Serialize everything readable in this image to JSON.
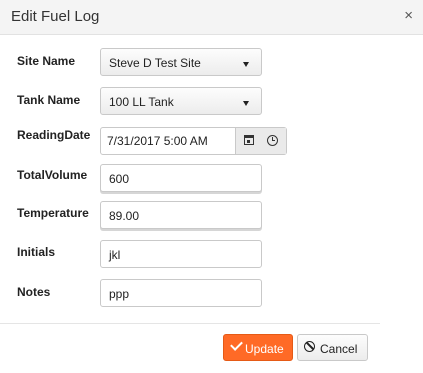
{
  "dialog": {
    "title": "Edit Fuel Log",
    "close_glyph": "×"
  },
  "form": {
    "site_name": {
      "label": "Site Name",
      "value": "Steve D Test Site"
    },
    "tank_name": {
      "label": "Tank Name",
      "value": "100 LL Tank"
    },
    "reading_date": {
      "label": "ReadingDate",
      "value": "7/31/2017 5:00 AM"
    },
    "total_volume": {
      "label": "TotalVolume",
      "value": "600"
    },
    "temperature": {
      "label": "Temperature",
      "value": "89.00"
    },
    "initials": {
      "label": "Initials",
      "value": "jkl"
    },
    "notes": {
      "label": "Notes",
      "value": "ppp"
    }
  },
  "actions": {
    "update_label": "Update",
    "cancel_label": "Cancel"
  },
  "colors": {
    "accent": "#ff6a26"
  },
  "icons": {
    "calendar": "calendar-icon",
    "clock": "clock-icon",
    "check": "check-icon",
    "cancel": "ban-icon"
  }
}
